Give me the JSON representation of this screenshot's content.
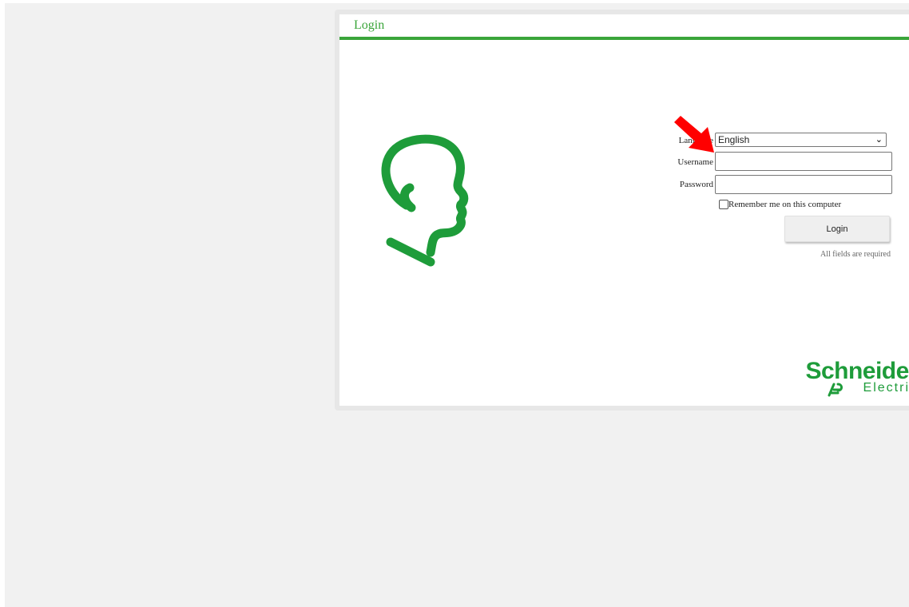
{
  "panel": {
    "title": "Login"
  },
  "form": {
    "language_label": "Language",
    "language_selected": "English",
    "username_label": "Username",
    "username_value": "",
    "password_label": "Password",
    "password_value": "",
    "remember_label": "Remember me on this computer",
    "remember_checked": false,
    "login_button": "Login",
    "required_note": "All fields are required"
  },
  "brand": {
    "line1": "Schneider",
    "line2": "Electric"
  },
  "icons": {
    "head": "head-profile-icon",
    "arrow": "red-arrow-annotation",
    "brand_mark": "schneider-electric-mark"
  },
  "colors": {
    "accent_green": "#3aa53a",
    "logo_green": "#1e9c3a",
    "arrow_red": "#ff0000",
    "background": "#f1f1f1"
  }
}
